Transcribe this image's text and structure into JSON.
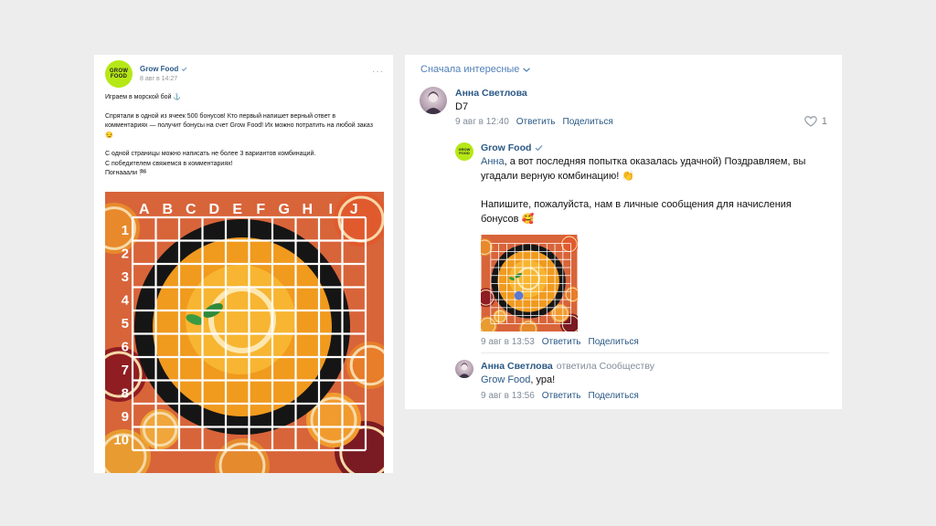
{
  "post": {
    "author": "Grow Food",
    "logo_line1": "GROW",
    "logo_line2": "FOOD",
    "date": "8 авг в 14:27",
    "text1": "Играем в морской бой ⚓",
    "text2": "Спрятали в одной из ячеек 500 бонусов! Кто первый напишет верный ответ в комментариях — получит бонусы на счет Grow Food! Их можно потратить на любой заказ 😏",
    "text3": "С одной страницы можно написать не более 3 вариантов комбинаций.",
    "text4": "С победителем свяжемся в комментариях!",
    "text5": "Погнааали 🏁",
    "columns": [
      "A",
      "B",
      "C",
      "D",
      "E",
      "F",
      "G",
      "H",
      "I",
      "J"
    ],
    "rows": [
      "1",
      "2",
      "3",
      "4",
      "5",
      "6",
      "7",
      "8",
      "9",
      "10"
    ]
  },
  "comments": {
    "sort_label": "Сначала интересные",
    "c1": {
      "name": "Анна Светлова",
      "text": "D7",
      "date": "9 авг в 12:40",
      "reply": "Ответить",
      "share": "Поделиться",
      "likes": "1"
    },
    "c2": {
      "name": "Grow Food",
      "mention": "Анна",
      "text1": ", а вот последняя попытка оказалась удачной) Поздравляем, вы угадали верную комбинацию! 👏",
      "text2": "Напишите, пожалуйста, нам в личные сообщения для начисления бонусов 🥰",
      "date": "9 авг в 13:53",
      "reply": "Ответить",
      "share": "Поделиться"
    },
    "c3": {
      "name": "Анна Светлова",
      "reply_to": "ответила Сообществу",
      "mention": "Grow Food",
      "text": ", ура!",
      "date": "9 авг в 13:56",
      "reply": "Ответить",
      "share": "Поделиться"
    }
  }
}
